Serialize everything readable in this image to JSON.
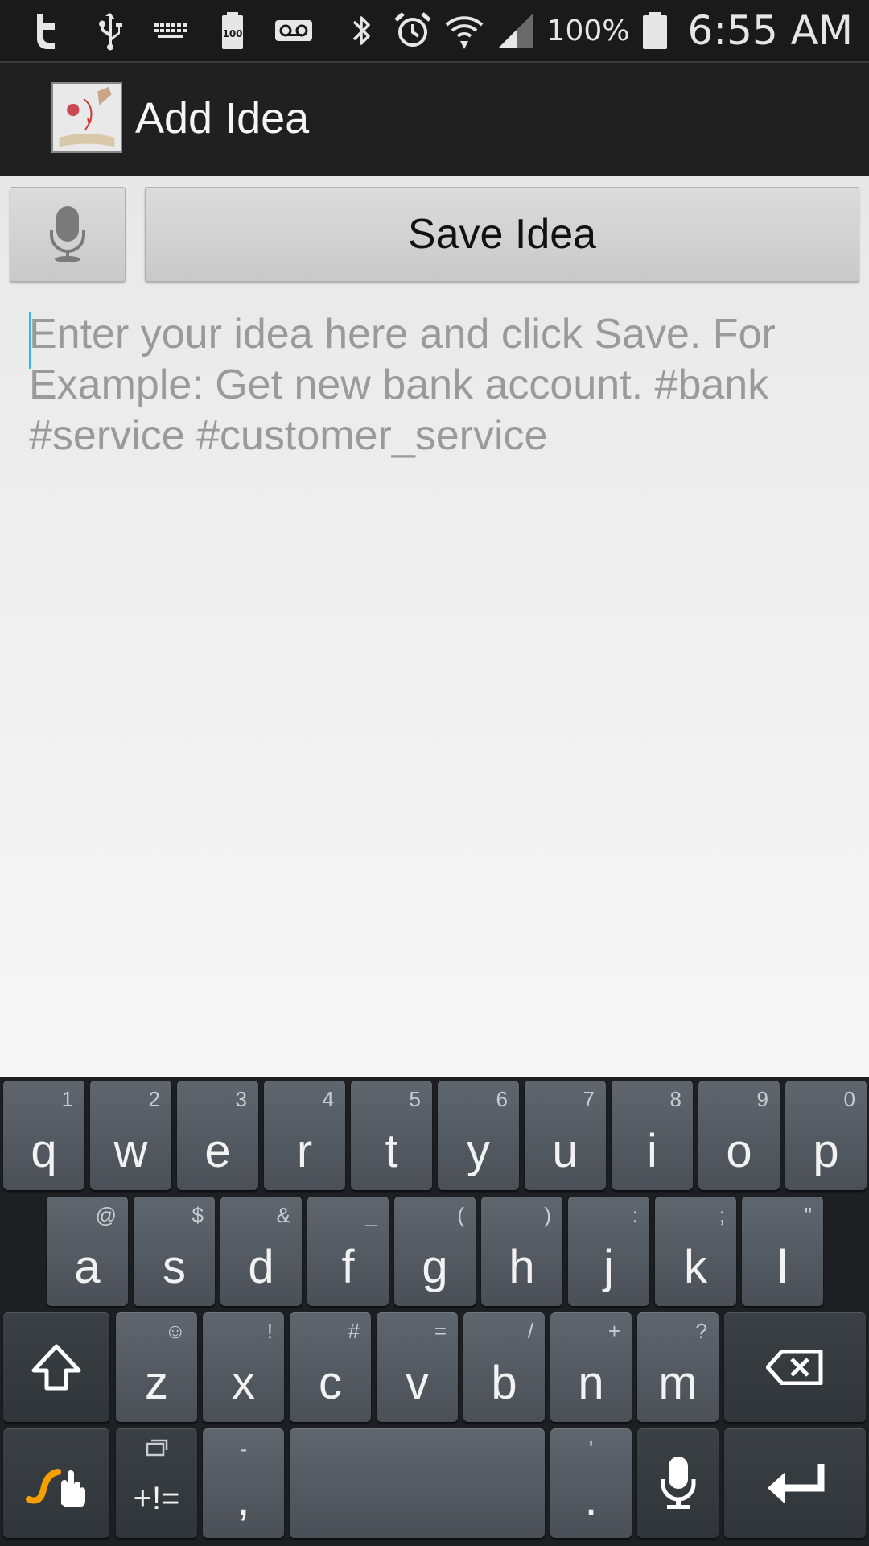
{
  "status_bar": {
    "battery_percent": "100%",
    "time": "6:55 AM",
    "battery_badge": "100",
    "icons_left": [
      "twitter-icon",
      "usb-icon",
      "keyboard-icon",
      "battery-full-icon",
      "voicemail-icon"
    ],
    "icons_right": [
      "bluetooth-icon",
      "alarm-icon",
      "wifi-icon",
      "signal-icon",
      "battery-icon"
    ]
  },
  "action_bar": {
    "title": "Add Idea",
    "logo_icon": "app-logo"
  },
  "toolbar": {
    "mic_icon": "microphone-icon",
    "save_label": "Save Idea"
  },
  "idea_input": {
    "placeholder": "Enter your idea here and click Save. For Example: Get new bank account. #bank #service #customer_service",
    "value": ""
  },
  "keyboard": {
    "row1": [
      {
        "k": "q",
        "h": "1"
      },
      {
        "k": "w",
        "h": "2"
      },
      {
        "k": "e",
        "h": "3"
      },
      {
        "k": "r",
        "h": "4"
      },
      {
        "k": "t",
        "h": "5"
      },
      {
        "k": "y",
        "h": "6"
      },
      {
        "k": "u",
        "h": "7"
      },
      {
        "k": "i",
        "h": "8"
      },
      {
        "k": "o",
        "h": "9"
      },
      {
        "k": "p",
        "h": "0"
      }
    ],
    "row2": [
      {
        "k": "a",
        "h": "@"
      },
      {
        "k": "s",
        "h": "$"
      },
      {
        "k": "d",
        "h": "&"
      },
      {
        "k": "f",
        "h": "_"
      },
      {
        "k": "g",
        "h": "("
      },
      {
        "k": "h",
        "h": ")"
      },
      {
        "k": "j",
        "h": ":"
      },
      {
        "k": "k",
        "h": ";"
      },
      {
        "k": "l",
        "h": "\""
      }
    ],
    "row3": [
      {
        "k": "z",
        "h": "☺"
      },
      {
        "k": "x",
        "h": "!"
      },
      {
        "k": "c",
        "h": "#"
      },
      {
        "k": "v",
        "h": "="
      },
      {
        "k": "b",
        "h": "/"
      },
      {
        "k": "n",
        "h": "+"
      },
      {
        "k": "m",
        "h": "?"
      }
    ],
    "symbols_label": "+!=",
    "comma": {
      "k": ",",
      "h": "-"
    },
    "period": {
      "k": ".",
      "h": "'"
    }
  },
  "colors": {
    "accent": "#33b5e5",
    "swype_orange": "#f5a000"
  }
}
